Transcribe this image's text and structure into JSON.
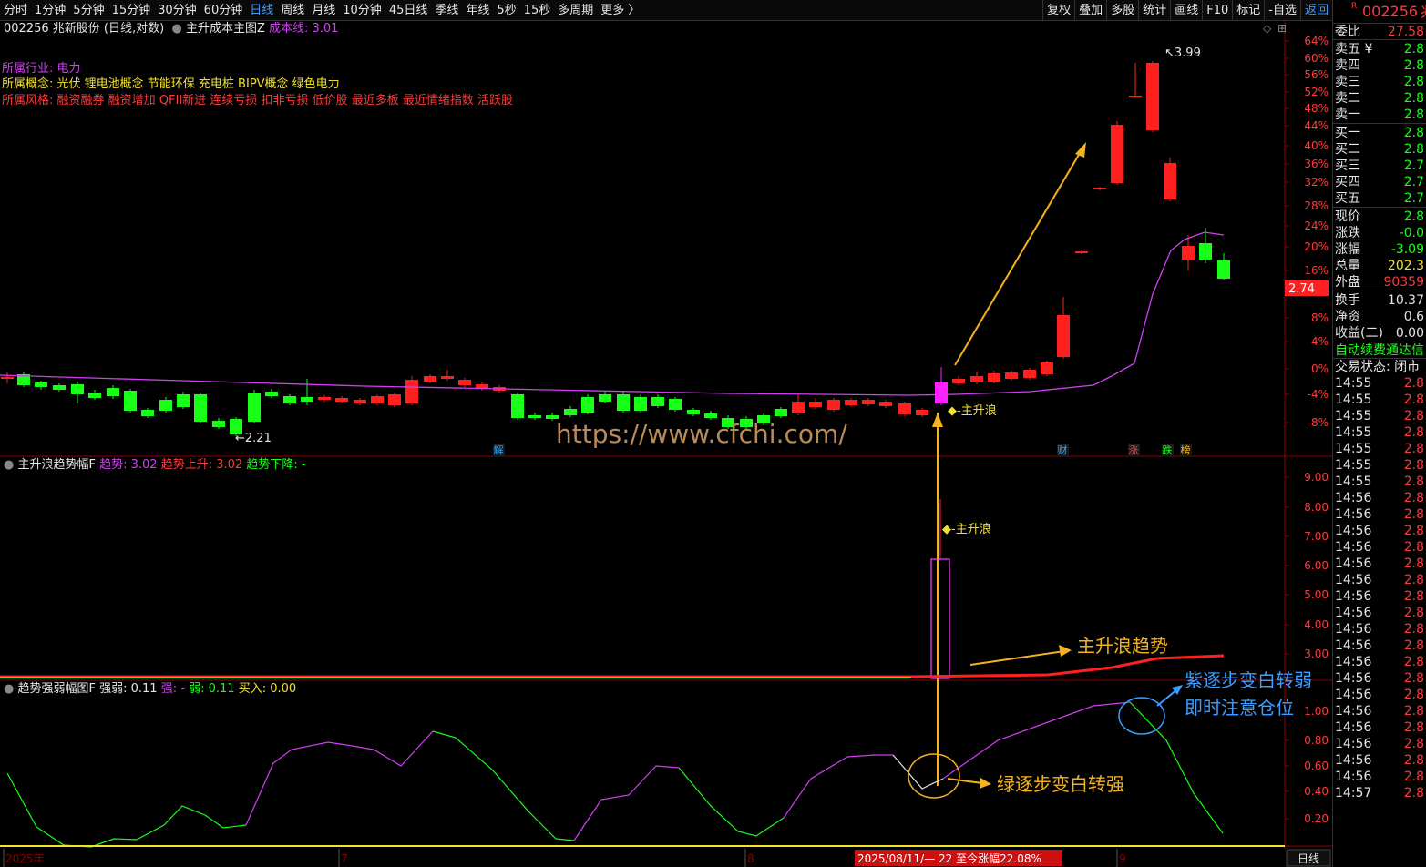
{
  "toolbar": {
    "periods": [
      "分时",
      "1分钟",
      "5分钟",
      "15分钟",
      "30分钟",
      "60分钟",
      "日线",
      "周线",
      "月线",
      "10分钟",
      "45日线",
      "季线",
      "年线",
      "5秒",
      "15秒",
      "多周期",
      "更多 〉"
    ],
    "active_period": "日线",
    "tools": [
      "复权",
      "叠加",
      "多股",
      "统计",
      "画线",
      "F10",
      "标记",
      "-自选",
      "返回"
    ]
  },
  "main_panel": {
    "stock": "002256 兆新股份 (日线,对数)",
    "indicator": "主升成本主图Z",
    "cost_label": "成本线: 3.01",
    "industry_label": "所属行业:",
    "industry": "电力",
    "concept_label": "所属概念:",
    "concepts": "光伏 锂电池概念 节能环保 充电桩 BIPV概念 绿色电力",
    "style_label": "所属风格:",
    "styles": "融资融券 融资增加 QFII新进 连续亏损 扣非亏损 低价股 最近多板 最近情绪指数 活跃股",
    "high_label": "3.99",
    "low_label": "2.21",
    "wave_label": "主升浪",
    "current_price_tag": "2.74",
    "watermark": "https://www.cfchi.com/",
    "event_tags": [
      "解",
      "财",
      "涨",
      "跌",
      "榜"
    ],
    "y_ticks": [
      "64%",
      "60%",
      "56%",
      "52%",
      "48%",
      "44%",
      "40%",
      "36%",
      "32%",
      "28%",
      "24%",
      "20%",
      "16%",
      "8%",
      "4%",
      "0%",
      "-4%",
      "-8%"
    ]
  },
  "panel2": {
    "title": "主升浪趋势幅F",
    "trend_label": "趋势: 3.02",
    "up_label": "趋势上升: 3.02",
    "down_label": "趋势下降: -",
    "wave_label": "主升浪",
    "annotation": "主升浪趋势",
    "y_ticks": [
      "9.00",
      "8.00",
      "7.00",
      "6.00",
      "5.00",
      "4.00",
      "3.00"
    ]
  },
  "panel3": {
    "title": "趋势强弱幅图F",
    "strength_label": "强弱: 0.11",
    "strong_label": "强: -",
    "weak_label": "弱: 0.11",
    "buy_label": "买入: 0.00",
    "note_weak_line1": "紫逐步变白转弱",
    "note_weak_line2": "即时注意仓位",
    "note_strong": "绿逐步变白转强",
    "y_ticks": [
      "1.00",
      "0.80",
      "0.60",
      "0.40",
      "0.20"
    ]
  },
  "bottom_axis": {
    "labels": [
      "2025年",
      "7",
      "8",
      "9"
    ],
    "range_label": "2025/08/11/— 22 至今涨幅22.08%",
    "period_button": "日线"
  },
  "right_panel": {
    "code": "002256",
    "code_suffix": "兆",
    "ratio_label": "委比",
    "ratio_value": "27.58",
    "sell_labels": [
      "卖五 ¥",
      "卖四",
      "卖三",
      "卖二",
      "卖一"
    ],
    "sell_values": [
      "2.8",
      "2.8",
      "2.8",
      "2.8",
      "2.8"
    ],
    "buy_labels": [
      "买一",
      "买二",
      "买三",
      "买四",
      "买五"
    ],
    "buy_values": [
      "2.8",
      "2.8",
      "2.7",
      "2.7",
      "2.7"
    ],
    "quote_labels": [
      "现价",
      "涨跌",
      "涨幅",
      "总量",
      "外盘"
    ],
    "quote_values": [
      "2.8",
      "-0.0",
      "-3.09",
      "202.3",
      "90359"
    ],
    "stat_labels": [
      "换手",
      "净资",
      "收益(二)"
    ],
    "stat_values": [
      "10.37",
      "0.6",
      "0.00"
    ],
    "fee_text": "自动续费通达信",
    "trade_status": "交易状态: 闭市",
    "ticks": [
      {
        "time": "14:55",
        "price": "2.8"
      },
      {
        "time": "14:55",
        "price": "2.8"
      },
      {
        "time": "14:55",
        "price": "2.8"
      },
      {
        "time": "14:55",
        "price": "2.8"
      },
      {
        "time": "14:55",
        "price": "2.8"
      },
      {
        "time": "14:55",
        "price": "2.8"
      },
      {
        "time": "14:55",
        "price": "2.8"
      },
      {
        "time": "14:56",
        "price": "2.8"
      },
      {
        "time": "14:56",
        "price": "2.8"
      },
      {
        "time": "14:56",
        "price": "2.8"
      },
      {
        "time": "14:56",
        "price": "2.8"
      },
      {
        "time": "14:56",
        "price": "2.8"
      },
      {
        "time": "14:56",
        "price": "2.8"
      },
      {
        "time": "14:56",
        "price": "2.8"
      },
      {
        "time": "14:56",
        "price": "2.8"
      },
      {
        "time": "14:56",
        "price": "2.8"
      },
      {
        "time": "14:56",
        "price": "2.8"
      },
      {
        "time": "14:56",
        "price": "2.8"
      },
      {
        "time": "14:56",
        "price": "2.8"
      },
      {
        "time": "14:56",
        "price": "2.8"
      },
      {
        "time": "14:56",
        "price": "2.8"
      },
      {
        "time": "14:56",
        "price": "2.8"
      },
      {
        "time": "14:56",
        "price": "2.8"
      },
      {
        "time": "14:56",
        "price": "2.8"
      },
      {
        "time": "14:56",
        "price": "2.8"
      },
      {
        "time": "14:57",
        "price": "2.8"
      }
    ]
  },
  "colors": {
    "up": "#ff2020",
    "down": "#18ff18",
    "cost_line": "#d040f0",
    "accent": "#f5b21f",
    "blue": "#3d9cff"
  }
}
